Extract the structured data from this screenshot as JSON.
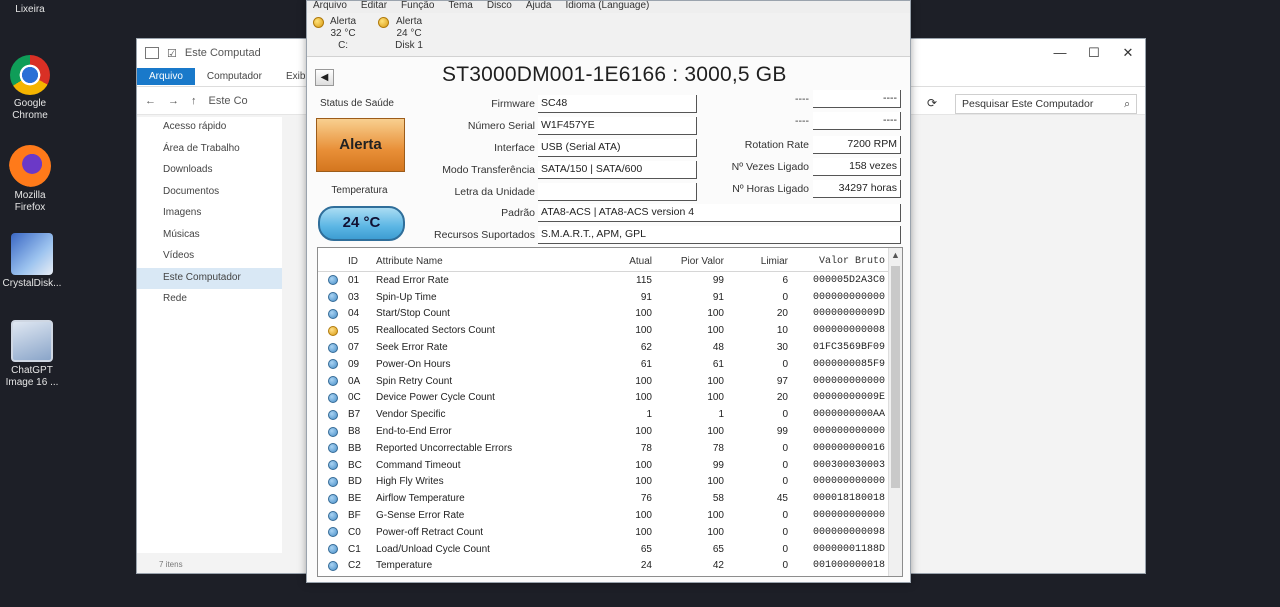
{
  "desktop": {
    "icons": [
      {
        "label": "Lixeira"
      },
      {
        "label": "Google Chrome"
      },
      {
        "label": "Mozilla Firefox"
      },
      {
        "label": "CrystalDisk..."
      },
      {
        "label": "ChatGPT Image 16 ..."
      }
    ]
  },
  "explorer": {
    "title": "Este Computad",
    "ribbon": [
      "Arquivo",
      "Computador",
      "Exib"
    ],
    "nav_path": "Este Co",
    "search_placeholder": "Pesquisar Este Computador",
    "sidebar": [
      "Acesso rápido",
      "Área de Trabalho",
      "Downloads",
      "Documentos",
      "Imagens",
      "Músicas",
      "Vídeos",
      "Este Computador",
      "Rede"
    ],
    "status": "7 itens"
  },
  "cdi": {
    "menu": [
      "Arquivo",
      "Editar",
      "Função",
      "Tema",
      "Disco",
      "Ajuda",
      "Idioma (Language)"
    ],
    "tabs": [
      {
        "status": "Alerta",
        "temp": "32 °C",
        "drive": "C:"
      },
      {
        "status": "Alerta",
        "temp": "24 °C",
        "drive": "Disk 1"
      }
    ],
    "model": "ST3000DM001-1E6166 : 3000,5 GB",
    "health_label": "Status de Saúde",
    "health_value": "Alerta",
    "temp_label": "Temperatura",
    "temp_value": "24 °C",
    "fields": {
      "firmware_label": "Firmware",
      "firmware": "SC48",
      "serial_label": "Número Serial",
      "serial": "W1F457YE",
      "interface_label": "Interface",
      "interface": "USB (Serial ATA)",
      "transfer_label": "Modo Transferência",
      "transfer": "SATA/150 | SATA/600",
      "letter_label": "Letra da Unidade",
      "letter": "",
      "standard_label": "Padrão",
      "standard": "ATA8-ACS | ATA8-ACS version 4",
      "features_label": "Recursos Suportados",
      "features": "S.M.A.R.T., APM, GPL",
      "dash_label": "----",
      "dash_value": "----",
      "rotation_label": "Rotation Rate",
      "rotation": "7200 RPM",
      "power_count_label": "Nº Vezes Ligado",
      "power_count": "158 vezes",
      "power_hours_label": "Nº Horas Ligado",
      "power_hours": "34297 horas"
    },
    "table": {
      "headers": {
        "id": "ID",
        "name": "Attribute Name",
        "atual": "Atual",
        "pior": "Pior Valor",
        "limiar": "Limiar",
        "bruto": "Valor Bruto"
      },
      "rows": [
        {
          "id": "01",
          "name": "Read Error Rate",
          "atual": "115",
          "pior": "99",
          "limiar": "6",
          "bruto": "000005D2A3C0",
          "warn": false
        },
        {
          "id": "03",
          "name": "Spin-Up Time",
          "atual": "91",
          "pior": "91",
          "limiar": "0",
          "bruto": "000000000000",
          "warn": false
        },
        {
          "id": "04",
          "name": "Start/Stop Count",
          "atual": "100",
          "pior": "100",
          "limiar": "20",
          "bruto": "00000000009D",
          "warn": false
        },
        {
          "id": "05",
          "name": "Reallocated Sectors Count",
          "atual": "100",
          "pior": "100",
          "limiar": "10",
          "bruto": "000000000008",
          "warn": true
        },
        {
          "id": "07",
          "name": "Seek Error Rate",
          "atual": "62",
          "pior": "48",
          "limiar": "30",
          "bruto": "01FC3569BF09",
          "warn": false
        },
        {
          "id": "09",
          "name": "Power-On Hours",
          "atual": "61",
          "pior": "61",
          "limiar": "0",
          "bruto": "0000000085F9",
          "warn": false
        },
        {
          "id": "0A",
          "name": "Spin Retry Count",
          "atual": "100",
          "pior": "100",
          "limiar": "97",
          "bruto": "000000000000",
          "warn": false
        },
        {
          "id": "0C",
          "name": "Device Power Cycle Count",
          "atual": "100",
          "pior": "100",
          "limiar": "20",
          "bruto": "00000000009E",
          "warn": false
        },
        {
          "id": "B7",
          "name": "Vendor Specific",
          "atual": "1",
          "pior": "1",
          "limiar": "0",
          "bruto": "0000000000AA",
          "warn": false
        },
        {
          "id": "B8",
          "name": "End-to-End Error",
          "atual": "100",
          "pior": "100",
          "limiar": "99",
          "bruto": "000000000000",
          "warn": false
        },
        {
          "id": "BB",
          "name": "Reported Uncorrectable Errors",
          "atual": "78",
          "pior": "78",
          "limiar": "0",
          "bruto": "000000000016",
          "warn": false
        },
        {
          "id": "BC",
          "name": "Command Timeout",
          "atual": "100",
          "pior": "99",
          "limiar": "0",
          "bruto": "000300030003",
          "warn": false
        },
        {
          "id": "BD",
          "name": "High Fly Writes",
          "atual": "100",
          "pior": "100",
          "limiar": "0",
          "bruto": "000000000000",
          "warn": false
        },
        {
          "id": "BE",
          "name": "Airflow Temperature",
          "atual": "76",
          "pior": "58",
          "limiar": "45",
          "bruto": "000018180018",
          "warn": false
        },
        {
          "id": "BF",
          "name": "G-Sense Error Rate",
          "atual": "100",
          "pior": "100",
          "limiar": "0",
          "bruto": "000000000000",
          "warn": false
        },
        {
          "id": "C0",
          "name": "Power-off Retract Count",
          "atual": "100",
          "pior": "100",
          "limiar": "0",
          "bruto": "000000000098",
          "warn": false
        },
        {
          "id": "C1",
          "name": "Load/Unload Cycle Count",
          "atual": "65",
          "pior": "65",
          "limiar": "0",
          "bruto": "00000001188D",
          "warn": false
        },
        {
          "id": "C2",
          "name": "Temperature",
          "atual": "24",
          "pior": "42",
          "limiar": "0",
          "bruto": "001000000018",
          "warn": false
        }
      ]
    }
  }
}
